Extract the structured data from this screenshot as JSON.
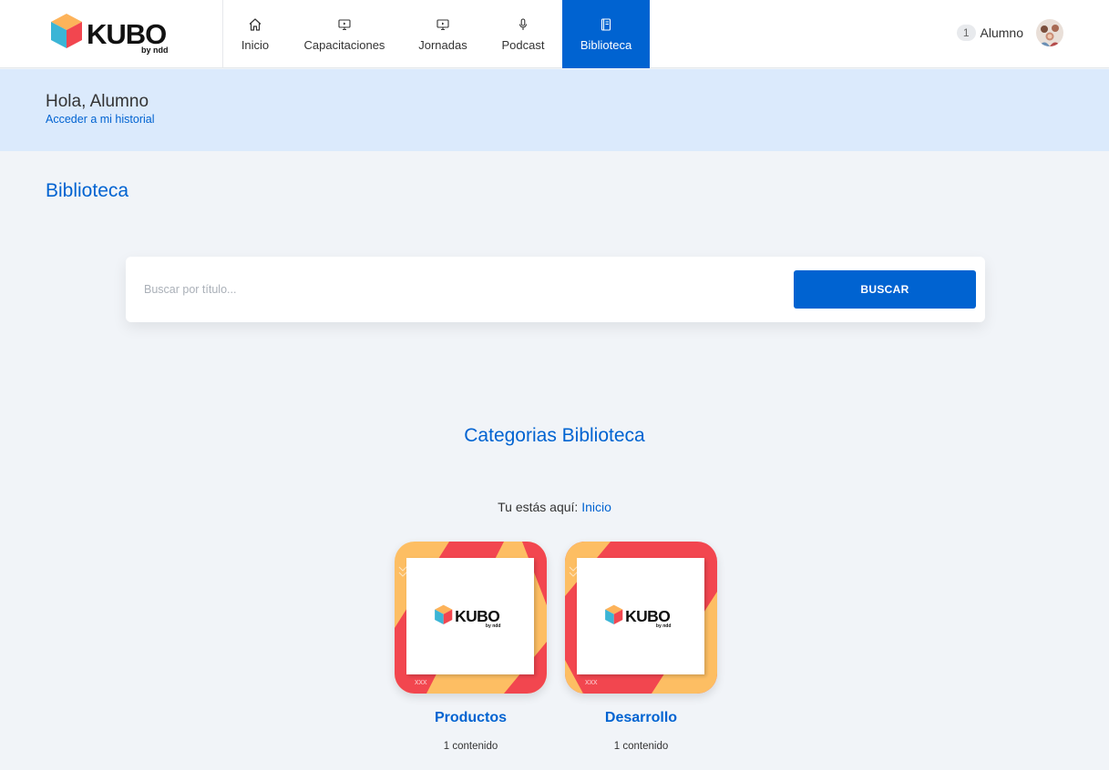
{
  "header": {
    "logo_text": "KUBO",
    "logo_sub": "by ndd",
    "nav": [
      {
        "label": "Inicio",
        "icon": "home-icon"
      },
      {
        "label": "Capacitaciones",
        "icon": "monitor-play-icon"
      },
      {
        "label": "Jornadas",
        "icon": "monitor-play-icon"
      },
      {
        "label": "Podcast",
        "icon": "microphone-icon"
      },
      {
        "label": "Biblioteca",
        "icon": "book-icon",
        "active": true
      }
    ],
    "notification_count": "1",
    "user_name": "Alumno"
  },
  "greeting": {
    "title": "Hola, Alumno",
    "history_link": "Acceder a mi historial"
  },
  "page_title": "Biblioteca",
  "search": {
    "placeholder": "Buscar por título...",
    "value": "",
    "button_label": "BUSCAR"
  },
  "categories_title": "Categorias Biblioteca",
  "breadcrumb": {
    "prefix": "Tu estás aquí:",
    "current": "Inicio"
  },
  "categories": [
    {
      "name": "Productos",
      "count": "1 contenido"
    },
    {
      "name": "Desarrollo",
      "count": "1 contenido"
    }
  ],
  "colors": {
    "primary": "#0063d1",
    "banner": "#dbeafc",
    "background": "#f1f4f8",
    "card_red": "#f2464f",
    "card_orange": "#fdbe63"
  }
}
